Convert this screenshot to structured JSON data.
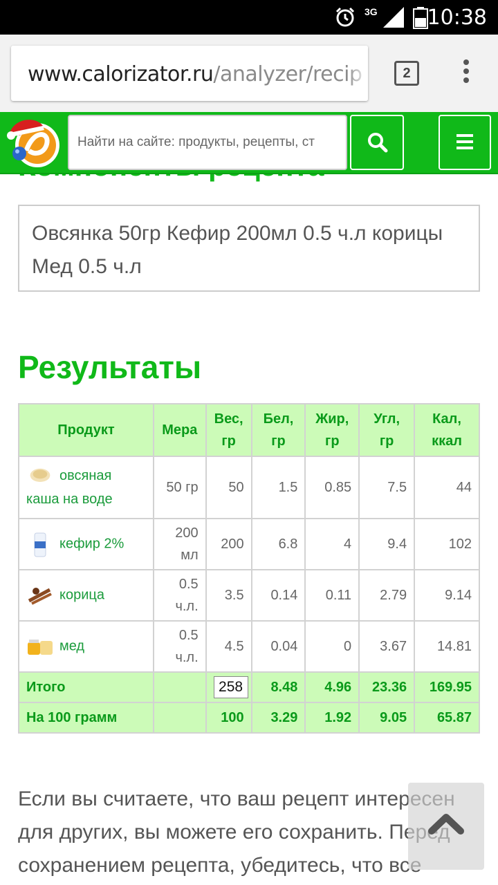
{
  "status_bar": {
    "time": "10:38",
    "network": "3G"
  },
  "browser": {
    "url_host": "www.calorizator.ru",
    "url_path": "/analyzer/recip",
    "tab_count": "2"
  },
  "header": {
    "search_placeholder": "Найти на сайте: продукты, рецепты, ст",
    "brand_color": "#10b919"
  },
  "page": {
    "cut_heading": "Компоненты рецепта",
    "ingredients_text": "Овсянка 50гр Кефир 200мл 0.5 ч.л корицы Мед 0.5 ч.л",
    "results_heading": "Результаты",
    "bottom_text": "Если вы считаете, что ваш рецепт интересен для других, вы можете его сохранить. Перед сохранением рецепта, убедитесь, что все"
  },
  "table": {
    "headers": {
      "product": "Продукт",
      "measure": "Мера",
      "weight": [
        "Вес,",
        "гр"
      ],
      "protein": [
        "Бел,",
        "гр"
      ],
      "fat": [
        "Жир,",
        "гр"
      ],
      "carbs": [
        "Угл,",
        "гр"
      ],
      "calories": [
        "Кал,",
        "ккал"
      ]
    },
    "rows": [
      {
        "icon": "oatmeal-icon",
        "name": "овсяная каша на воде",
        "measure": "50 гр",
        "weight": "50",
        "protein": "1.5",
        "fat": "0.85",
        "carbs": "7.5",
        "calories": "44"
      },
      {
        "icon": "kefir-icon",
        "name": "кефир 2%",
        "measure": "200 мл",
        "weight": "200",
        "protein": "6.8",
        "fat": "4",
        "carbs": "9.4",
        "calories": "102"
      },
      {
        "icon": "cinnamon-icon",
        "name": "корица",
        "measure": "0.5 ч.л.",
        "weight": "3.5",
        "protein": "0.14",
        "fat": "0.11",
        "carbs": "2.79",
        "calories": "9.14"
      },
      {
        "icon": "honey-icon",
        "name": "мед",
        "measure": "0.5 ч.л.",
        "weight": "4.5",
        "protein": "0.04",
        "fat": "0",
        "carbs": "3.67",
        "calories": "14.81"
      }
    ],
    "total": {
      "label": "Итого",
      "weight": "258",
      "protein": "8.48",
      "fat": "4.96",
      "carbs": "23.36",
      "calories": "169.95"
    },
    "per100": {
      "label": "На 100 грамм",
      "weight": "100",
      "protein": "3.29",
      "fat": "1.92",
      "carbs": "9.05",
      "calories": "65.87"
    }
  }
}
